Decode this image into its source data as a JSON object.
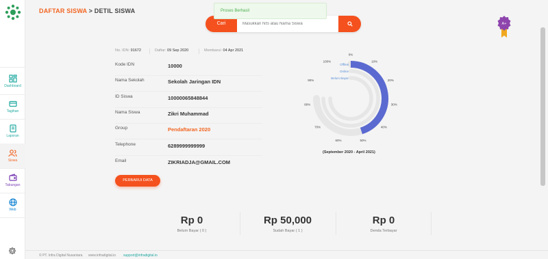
{
  "header": {
    "breadcrumb": "DAFTAR SISWA",
    "separator": ">",
    "current": "DETIL SISWA"
  },
  "toast": {
    "message": "Proses Berhasil"
  },
  "search": {
    "button_label": "Cari",
    "placeholder": "Masukkan NIS atau Nama Siswa"
  },
  "sidebar": {
    "items": [
      {
        "label": "Dashboard",
        "icon": "dashboard-icon"
      },
      {
        "label": "Tagihan",
        "icon": "bill-icon"
      },
      {
        "label": "Laporan",
        "icon": "report-icon"
      },
      {
        "label": "Siswa",
        "icon": "students-icon"
      },
      {
        "label": "Tabungan",
        "icon": "wallet-icon"
      },
      {
        "label": "Web",
        "icon": "globe-icon"
      }
    ],
    "active": "Siswa"
  },
  "meta": {
    "no_idn_label": "No. IDN:",
    "no_idn_value": "91672",
    "daftar_label": "Daftar:",
    "daftar_value": "09 Sep 2020",
    "membaru_label": "Membarui:",
    "membaru_value": "04 Apr 2021"
  },
  "details": [
    {
      "label": "Kode IDN",
      "value": "10000"
    },
    {
      "label": "Nama Sekolah",
      "value": "Sekolah Jaringan IDN"
    },
    {
      "label": "ID Siswa",
      "value": "10000065848844"
    },
    {
      "label": "Nama Siswa",
      "value": "Zikri Muhammad"
    },
    {
      "label": "Group",
      "value": "Pendaftaran 2020"
    },
    {
      "label": "Telephone",
      "value": "6289999999999"
    },
    {
      "label": "Email",
      "value": "ZIKRIADJA@GMAIL.COM"
    }
  ],
  "update_button": "PERBARUI DATA",
  "chart_data": {
    "type": "radial-bar",
    "categories": [
      "Offline",
      "Online",
      "Belum Bayar"
    ],
    "values": [
      60,
      0,
      0
    ],
    "tick_labels": [
      "0%",
      "10%",
      "20%",
      "30%",
      "40%",
      "50%",
      "60%",
      "70%",
      "80%",
      "90%",
      "100%"
    ],
    "caption": "(September 2020 - April 2021)",
    "colors": {
      "offline": "#5b6ad0",
      "track": "#e6e6e6",
      "label": "#5b8fd6"
    }
  },
  "summary": [
    {
      "amount": "Rp 0",
      "label": "Belum Bayar ( 0 )"
    },
    {
      "amount": "Rp 50,000",
      "label": "Sudah Bayar ( 1 )"
    },
    {
      "amount": "Rp 0",
      "label": "Denda Terbayar"
    }
  ],
  "footer": {
    "company": "© PT. Infra Digital Nusantara",
    "site": "www.infradigital.io",
    "email": "support@infradigital.io"
  },
  "badge": {
    "text": "A+"
  },
  "colors": {
    "accent": "#f4511e",
    "teal": "#1fa8a0"
  }
}
